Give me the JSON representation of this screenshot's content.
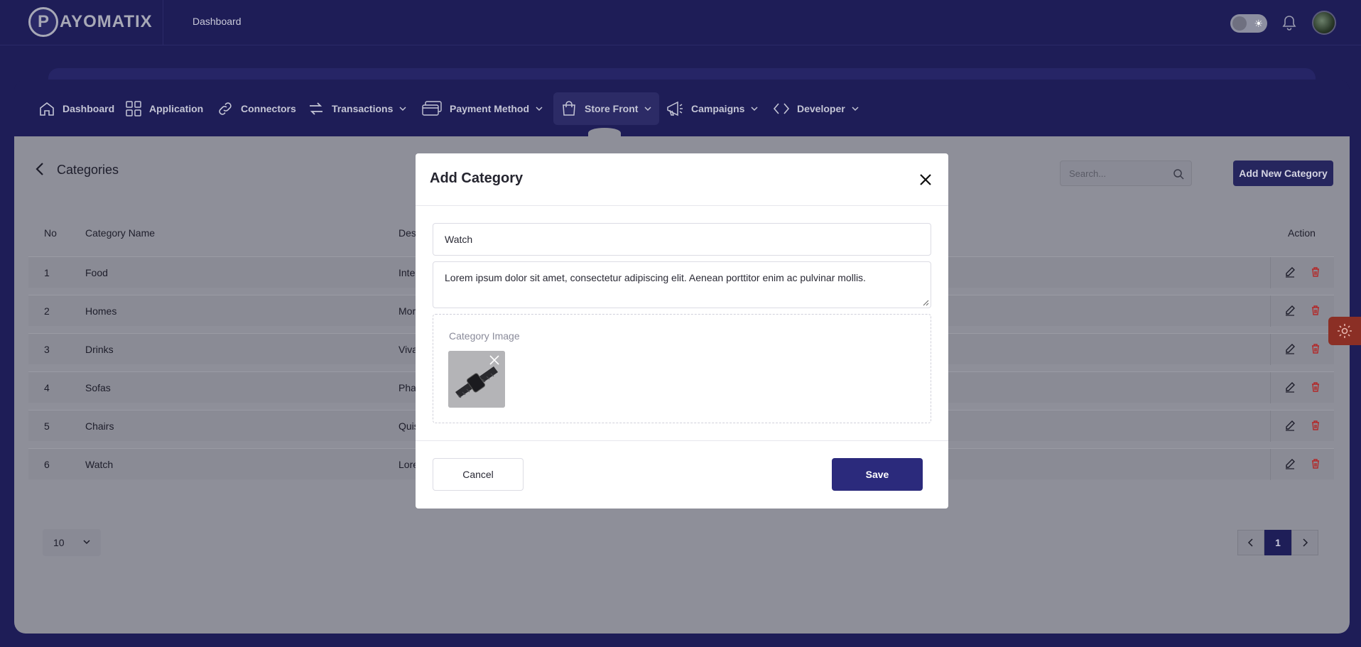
{
  "brand": {
    "logo_letter": "P",
    "logo_text": "AYOMATIX"
  },
  "topbar": {
    "title": "Dashboard"
  },
  "nav": [
    {
      "label": "Dashboard",
      "icon": "home-icon"
    },
    {
      "label": "Application",
      "icon": "grid-icon"
    },
    {
      "label": "Connectors",
      "icon": "link-icon"
    },
    {
      "label": "Transactions",
      "icon": "arrows-icon"
    },
    {
      "label": "Payment Method",
      "icon": "cards-icon"
    },
    {
      "label": "Store Front",
      "icon": "bag-icon"
    },
    {
      "label": "Campaigns",
      "icon": "megaphone-icon"
    },
    {
      "label": "Developer",
      "icon": "code-icon"
    }
  ],
  "page": {
    "title": "Categories",
    "search_placeholder": "Search...",
    "add_button": "Add New Category"
  },
  "table": {
    "headers": {
      "no": "No",
      "name": "Category Name",
      "desc": "Des",
      "action": "Action"
    },
    "rows": [
      {
        "no": "1",
        "name": "Food",
        "desc": "Inte"
      },
      {
        "no": "2",
        "name": "Homes",
        "desc": "Mor"
      },
      {
        "no": "3",
        "name": "Drinks",
        "desc": "Viva"
      },
      {
        "no": "4",
        "name": "Sofas",
        "desc": "Pha"
      },
      {
        "no": "5",
        "name": "Chairs",
        "desc": "Quis"
      },
      {
        "no": "6",
        "name": "Watch",
        "desc": "Lore"
      }
    ]
  },
  "pagination": {
    "per_page": "10",
    "current_page": "1"
  },
  "modal": {
    "title": "Add Category",
    "name_value": "Watch",
    "description_value": "Lorem ipsum dolor sit amet, consectetur adipiscing elit. Aenean porttitor enim ac pulvinar mollis.",
    "image_label": "Category Image",
    "cancel_label": "Cancel",
    "save_label": "Save"
  },
  "colors": {
    "brand_navy": "#1e1d57",
    "save": "#2b2a7c",
    "delete": "#b32828",
    "settings_tab": "#8b2f25"
  }
}
